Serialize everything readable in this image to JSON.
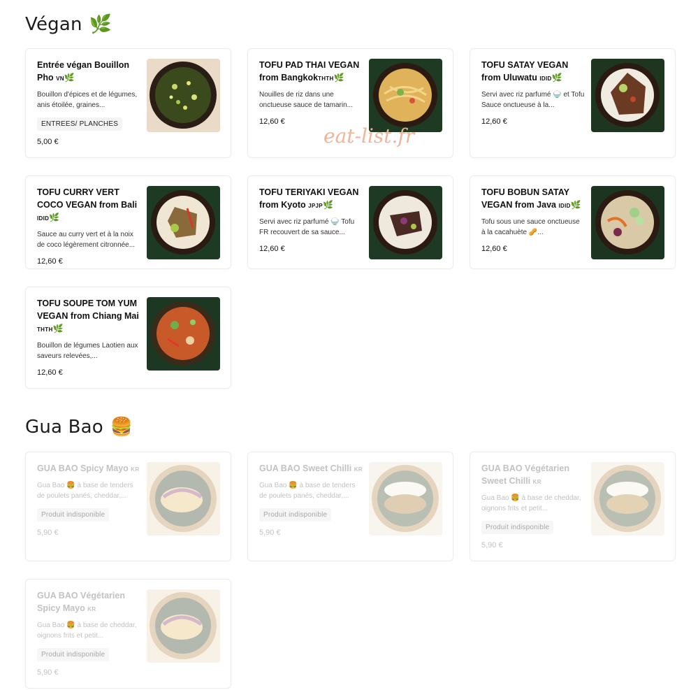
{
  "watermark": "eat-list.fr",
  "sections": {
    "vegan": {
      "title": "Végan",
      "icon": "leaf-icon",
      "emoji": "🌿",
      "items": [
        {
          "name": "Entrée végan Bouillon Pho",
          "flag": "VN",
          "desc": "Bouillon d'épices et de légumes, anis étoilée, graines...",
          "tag": "ENTREES/ PLANCHES",
          "price": "5,00 €"
        },
        {
          "name": "TOFU PAD THAI VEGAN from Bangkok",
          "flag": "THTH",
          "desc": "Nouilles de riz dans une onctueuse sauce de tamarin...",
          "price": "12,60 €"
        },
        {
          "name": "TOFU SATAY VEGAN from Uluwatu",
          "flag": "IDID",
          "desc": "Servi avec riz parfumé 🍚 et Tofu Sauce onctueuse à la...",
          "price": "12,60 €"
        },
        {
          "name": "TOFU CURRY VERT COCO VEGAN from Bali",
          "flag": "IDID",
          "desc": "Sauce au curry vert et à la noix de coco légèrement citronnée...",
          "price": "12,60 €"
        },
        {
          "name": "TOFU TERIYAKI VEGAN from Kyoto",
          "flag": "JPJP",
          "desc": "Servi avec riz parfumé 🍚 Tofu FR recouvert de sa sauce...",
          "price": "12,60 €"
        },
        {
          "name": "TOFU BOBUN SATAY VEGAN from Java",
          "flag": "IDID",
          "desc": "Tofu sous une sauce onctueuse à la cacahuète 🥜...",
          "price": "12,60 €"
        },
        {
          "name": "TOFU SOUPE TOM YUM VEGAN from Chiang Mai",
          "flag": "THTH",
          "desc": "Bouillon de légumes Laotien aux saveurs relevées,...",
          "price": "12,60 €"
        }
      ]
    },
    "guabao": {
      "title": "Gua Bao",
      "icon": "burger-icon",
      "emoji": "🍔",
      "items": [
        {
          "name": "GUA BAO Spicy Mayo",
          "flag": "KR",
          "desc": "Gua Bao 🍔 à base de tenders de poulets panés, cheddar,...",
          "tag": "Produit indisponible",
          "price": "5,90 €"
        },
        {
          "name": "GUA BAO Sweet Chilli",
          "flag": "KR",
          "desc": "Gua Bao 🍔 à base de tenders de poulets panés, cheddar,...",
          "tag": "Produit indisponible",
          "price": "5,90 €"
        },
        {
          "name": "GUA BAO Végétarien Sweet Chilli",
          "flag": "KR",
          "desc": "Gua Bao 🍔 à base de cheddar, oignons frits et petit...",
          "tag": "Produit indisponible",
          "price": "5,90 €"
        },
        {
          "name": "GUA BAO Végétarien Spicy Mayo",
          "flag": "KR",
          "desc": "Gua Bao 🍔 à base de cheddar, oignons frits et petit...",
          "tag": "Produit indisponible",
          "price": "5,90 €"
        }
      ]
    }
  }
}
